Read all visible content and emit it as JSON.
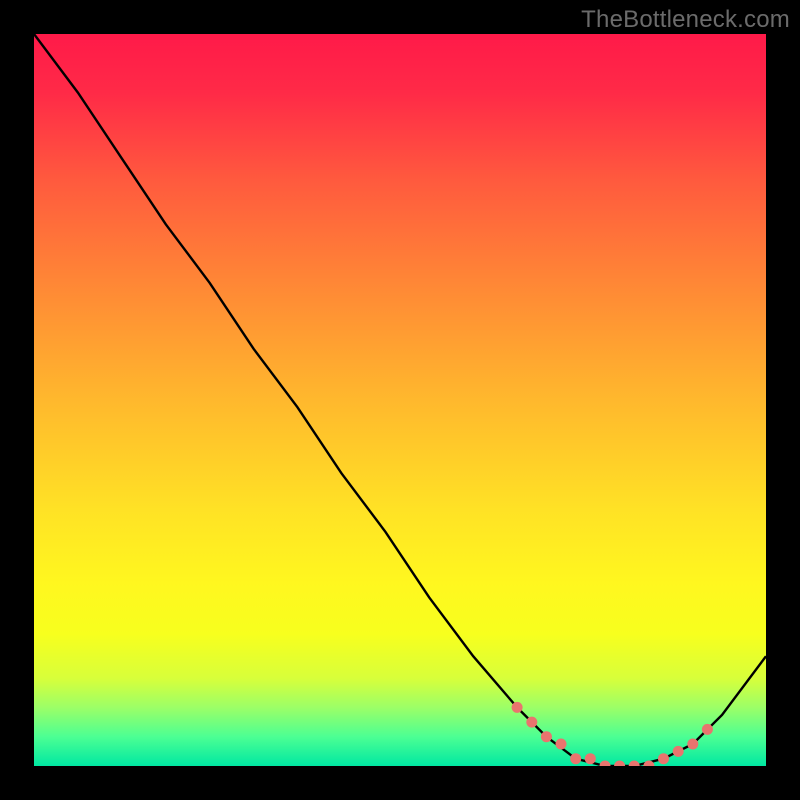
{
  "watermark": "TheBottleneck.com",
  "chart_data": {
    "type": "line",
    "title": "",
    "xlabel": "",
    "ylabel": "",
    "xlim": [
      0,
      100
    ],
    "ylim": [
      0,
      100
    ],
    "series": [
      {
        "name": "curve",
        "x": [
          0,
          6,
          12,
          18,
          24,
          30,
          36,
          42,
          48,
          54,
          60,
          66,
          70,
          74,
          78,
          82,
          86,
          90,
          94,
          100
        ],
        "y": [
          100,
          92,
          83,
          74,
          66,
          57,
          49,
          40,
          32,
          23,
          15,
          8,
          4,
          1,
          0,
          0,
          1,
          3,
          7,
          15
        ]
      }
    ],
    "markers": {
      "name": "dots",
      "x": [
        66,
        68,
        70,
        72,
        74,
        76,
        78,
        80,
        82,
        84,
        86,
        88,
        90,
        92
      ],
      "y": [
        8,
        6,
        4,
        3,
        1,
        1,
        0,
        0,
        0,
        0,
        1,
        2,
        3,
        5
      ]
    },
    "marker_color": "#e9746e",
    "line_color": "#000000",
    "background_gradient": [
      "#ff1a49",
      "#ffe225",
      "#00e8a2"
    ]
  }
}
